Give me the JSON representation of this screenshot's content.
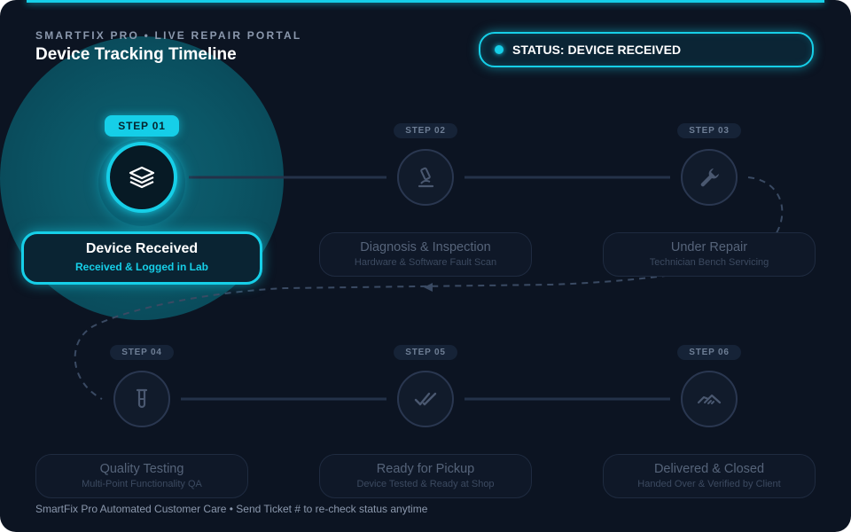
{
  "header": {
    "brand": "SMARTFIX PRO • LIVE REPAIR PORTAL",
    "title": "Device Tracking Timeline"
  },
  "status": {
    "text": "STATUS: DEVICE RECEIVED"
  },
  "steps": [
    {
      "tag": "STEP 01",
      "title": "Device Received",
      "subtitle": "Received & Logged in Lab",
      "icon": "layers-icon",
      "active": true
    },
    {
      "tag": "STEP 02",
      "title": "Diagnosis & Inspection",
      "subtitle": "Hardware & Software Fault Scan",
      "icon": "microscope-icon",
      "active": false
    },
    {
      "tag": "STEP 03",
      "title": "Under Repair",
      "subtitle": "Technician Bench Servicing",
      "icon": "wrench-icon",
      "active": false
    },
    {
      "tag": "STEP 04",
      "title": "Quality Testing",
      "subtitle": "Multi-Point Functionality QA",
      "icon": "test-tube-icon",
      "active": false
    },
    {
      "tag": "STEP 05",
      "title": "Ready for Pickup",
      "subtitle": "Device Tested & Ready at Shop",
      "icon": "double-check-icon",
      "active": false
    },
    {
      "tag": "STEP 06",
      "title": "Delivered & Closed",
      "subtitle": "Handed Over & Verified by Client",
      "icon": "handshake-icon",
      "active": false
    }
  ],
  "footer": {
    "text": "SmartFix Pro Automated Customer Care • Send Ticket # to re-check status anytime"
  },
  "colors": {
    "background": "#0c1422",
    "accent": "#16cfe8",
    "inactive_text": "#56647a",
    "active_glow": "#0b5767"
  }
}
